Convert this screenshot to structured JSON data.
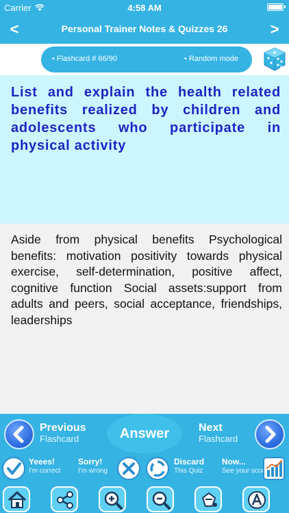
{
  "status_bar": {
    "carrier": "Carrier",
    "time": "4:58 AM"
  },
  "nav": {
    "title": "Personal Trainer Notes & Quizzes 26",
    "prev": "<",
    "next": ">"
  },
  "info": {
    "flashcard_label": "• Flashcard #  66/90",
    "mode_label": "• Random mode"
  },
  "question": "List and explain the health related benefits realized by children and adolescents who participate in physical activity",
  "answer": "Aside from physical benefits  Psychological benefits: motivation positivity towards physical exercise, self-determination, positive affect, cognitive function  Social assets:support from adults and peers, social acceptance, friendships, leaderships",
  "bottom_nav": {
    "previous": {
      "title": "Previous",
      "subtitle": "Flashcard"
    },
    "answer": "Answer",
    "next": {
      "title": "Next",
      "subtitle": "Flashcard"
    }
  },
  "actions": [
    {
      "title": "Yeees!",
      "subtitle": "I'm correct"
    },
    {
      "title": "Sorry!",
      "subtitle": "I'm wrong"
    },
    {
      "title": "Discard",
      "subtitle": "This Quiz"
    },
    {
      "title": "Now...",
      "subtitle": "See your score"
    }
  ],
  "colors": {
    "primary": "#35b3e3",
    "question_bg": "#ccf6fd",
    "question_text": "#1c24c4",
    "answer_bg": "#f1f1f1"
  },
  "toolbar_icons": [
    "home-icon",
    "share-icon",
    "zoom-in-icon",
    "zoom-out-icon",
    "theme-icon",
    "font-icon"
  ]
}
